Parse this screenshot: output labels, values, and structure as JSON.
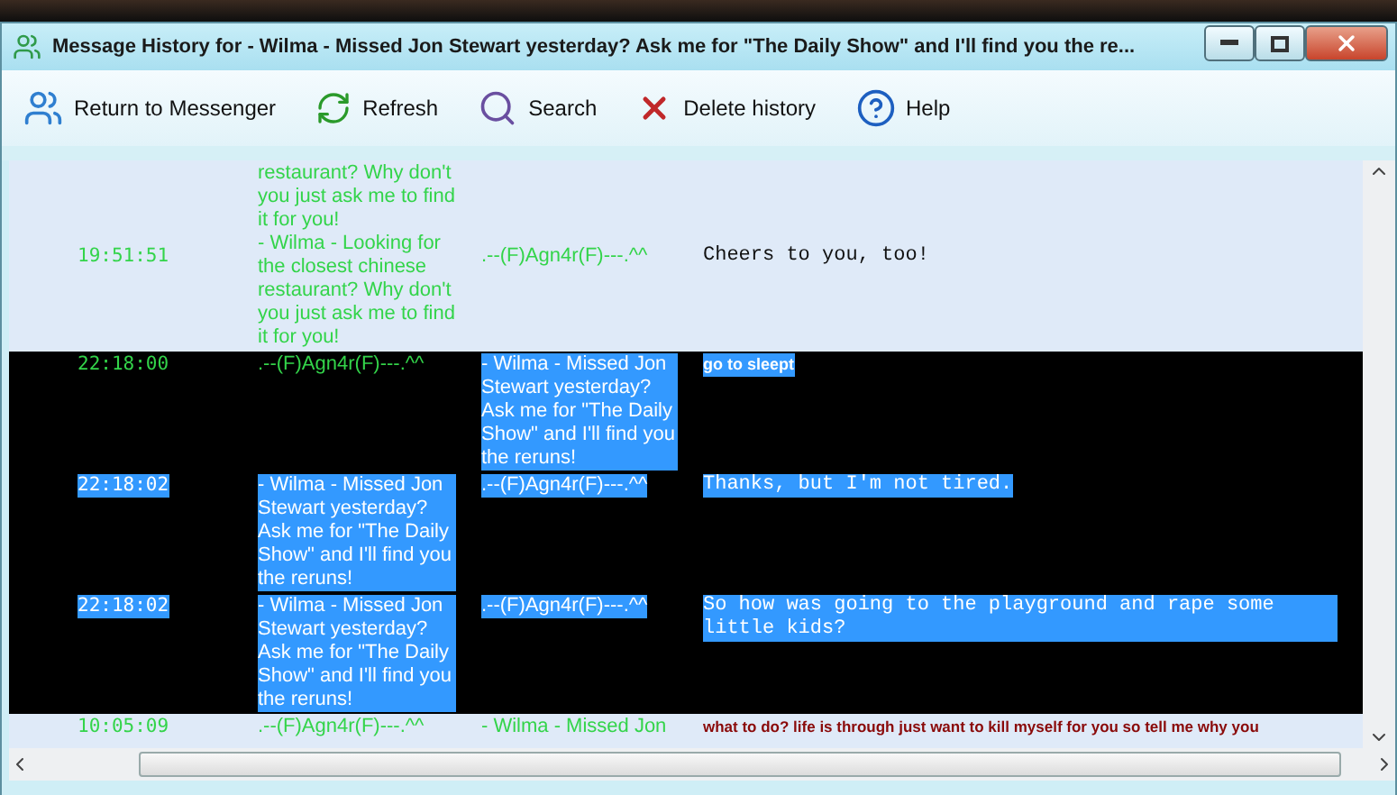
{
  "window": {
    "title": "Message History for - Wilma - Missed Jon Stewart yesterday? Ask me for \"The Daily Show\" and I'll find you the re..."
  },
  "toolbar": [
    {
      "label": "Return to Messenger"
    },
    {
      "label": "Refresh"
    },
    {
      "label": "Search"
    },
    {
      "label": "Delete history"
    },
    {
      "label": "Help"
    }
  ],
  "rows": [
    {
      "selected": false,
      "time": {
        "text": "19:51:51",
        "highlighted": false
      },
      "from": [
        {
          "text": "restaurant? Why don't you just ask me to find it for you!",
          "highlighted": false
        },
        {
          "text": "- Wilma - Looking for the closest chinese restaurant? Why don't you just ask me to find it for you!",
          "highlighted": false
        }
      ],
      "to": {
        "text": ".--(F)Agn4r(F)---.^^",
        "highlighted": false
      },
      "message": {
        "text": "Cheers to you, too!",
        "kind": "mono",
        "highlighted": false
      }
    },
    {
      "selected": true,
      "time": {
        "text": "22:18:00",
        "highlighted": false
      },
      "from": [
        {
          "text": ".--(F)Agn4r(F)---.^^",
          "highlighted": false
        }
      ],
      "to": {
        "text": "- Wilma - Missed Jon Stewart yesterday? Ask me for \"The Daily Show\" and I'll find you the reruns!",
        "highlighted": true
      },
      "message": {
        "text": "go to sleept",
        "kind": "bold",
        "highlighted": true
      }
    },
    {
      "selected": true,
      "time": {
        "text": "22:18:02",
        "highlighted": true
      },
      "from": [
        {
          "text": "- Wilma - Missed Jon Stewart yesterday? Ask me for \"The Daily Show\" and I'll find you the reruns!",
          "highlighted": true
        }
      ],
      "to": {
        "text": ".--(F)Agn4r(F)---.^^",
        "highlighted": true
      },
      "message": {
        "text": "Thanks, but I'm not tired.",
        "kind": "mono",
        "highlighted": true
      }
    },
    {
      "selected": true,
      "time": {
        "text": "22:18:02",
        "highlighted": true
      },
      "from": [
        {
          "text": "- Wilma - Missed Jon Stewart yesterday? Ask me for \"The Daily Show\" and I'll find you the reruns!",
          "highlighted": true
        }
      ],
      "to": {
        "text": ".--(F)Agn4r(F)---.^^",
        "highlighted": true
      },
      "message": {
        "text": "So how was going to the playground and rape some little kids?",
        "kind": "mono",
        "highlighted": true
      }
    },
    {
      "selected": false,
      "time": {
        "text": "10:05:09",
        "highlighted": false
      },
      "from": [
        {
          "text": ".--(F)Agn4r(F)---.^^",
          "highlighted": false
        }
      ],
      "to": {
        "text": "- Wilma - Missed Jon",
        "highlighted": false
      },
      "message": {
        "text": "what to do? life is through just want to kill myself for you so tell me why you",
        "kind": "red",
        "highlighted": false
      }
    }
  ]
}
